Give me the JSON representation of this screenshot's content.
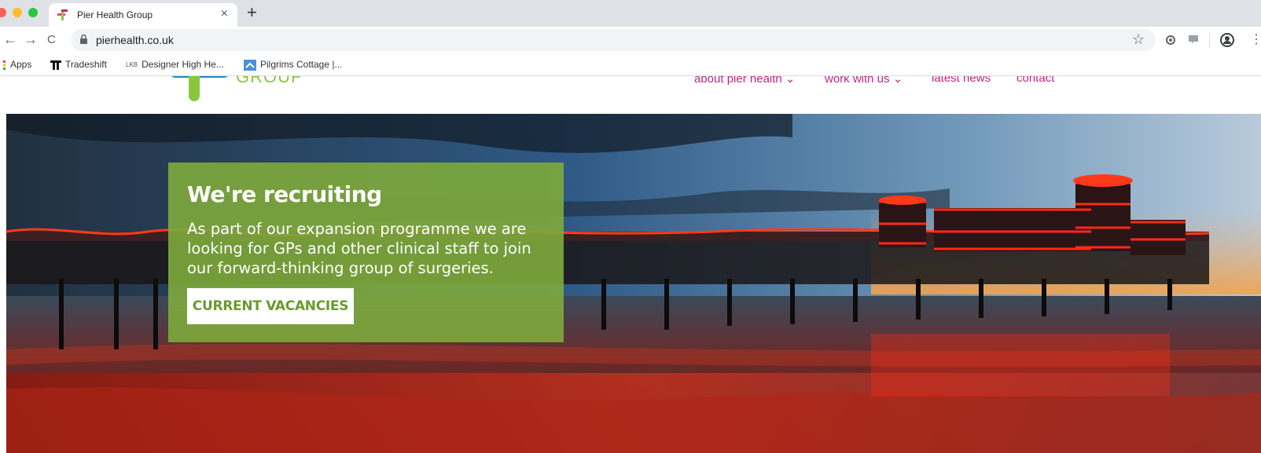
{
  "browser": {
    "tab_title": "Pier Health Group",
    "tab_close": "×",
    "new_tab": "+",
    "url": "pierhealth.co.uk",
    "back": "←",
    "forward": "→",
    "reload": "C",
    "star": "☆",
    "bookmarks": [
      {
        "label": "Apps",
        "icon": "apps-grid-icon"
      },
      {
        "label": "Tradeshift",
        "icon": "tradeshift-icon"
      },
      {
        "label": "Designer High He...",
        "icon": "lkb-icon",
        "prefix": "LKB"
      },
      {
        "label": "Pilgrims Cottage |...",
        "icon": "pilgrims-icon"
      }
    ]
  },
  "site": {
    "logo_text": "GROUP",
    "nav": [
      {
        "label": "about pier health ⌄"
      },
      {
        "label": "work with us ⌄"
      },
      {
        "label": "latest news"
      },
      {
        "label": "contact"
      }
    ],
    "hero": {
      "title": "We're recruiting",
      "text": "As part of our expansion programme we are looking for GPs and other clinical staff to join our forward-thinking group of surgeries.",
      "button": "CURRENT VACANCIES"
    }
  },
  "colors": {
    "brand_pink": "#c0267e",
    "brand_green": "#8cc63f",
    "promo_green": "#7eaa3c"
  }
}
